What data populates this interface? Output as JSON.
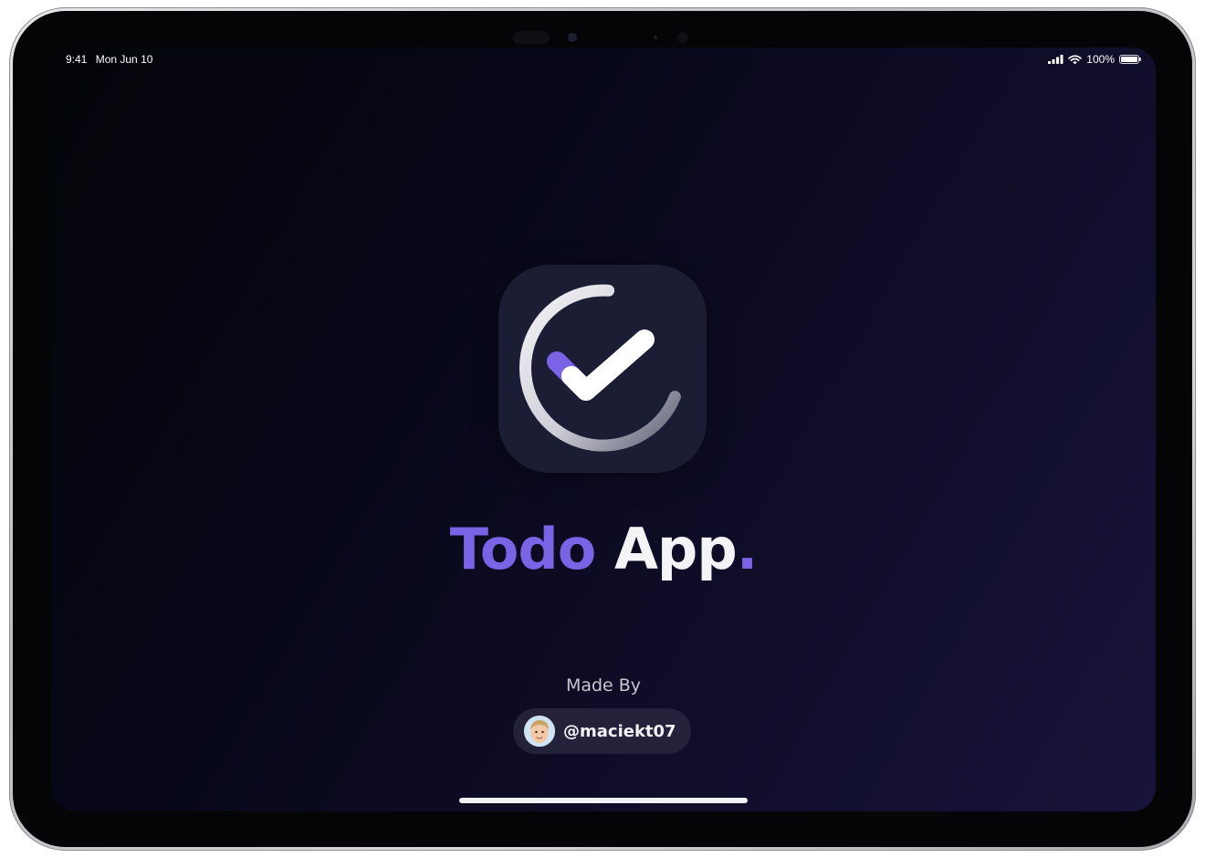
{
  "status_bar": {
    "time": "9:41",
    "date": "Mon Jun 10",
    "battery": "100%",
    "battery_level": 1.0,
    "icons": [
      "cellular-signal-icon",
      "wifi-icon",
      "battery-icon"
    ]
  },
  "app_icon": {
    "icon": "checkmark-progress-icon",
    "accent_color": "#7b63e6",
    "background_color": "#1a1d34"
  },
  "title": {
    "part1": "Todo",
    "part2": "App",
    "dot": "."
  },
  "credits": {
    "made_by_label": "Made By",
    "author_handle": "@maciekt07"
  },
  "colors": {
    "accent": "#7b63e6",
    "text_primary": "#f4f4f6",
    "chip_background": "#24223a"
  }
}
